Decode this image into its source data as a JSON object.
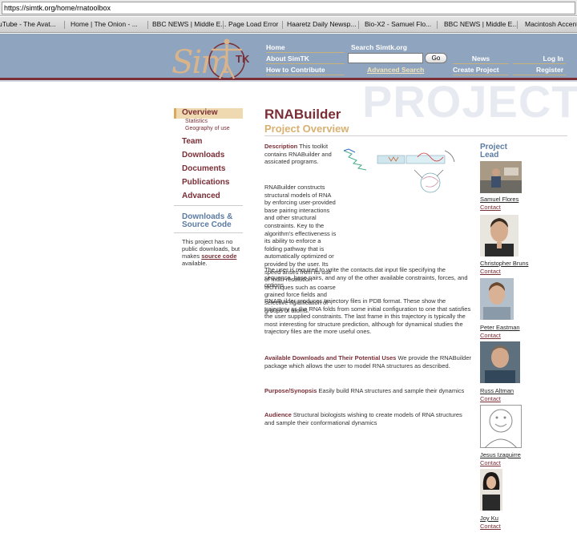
{
  "browser": {
    "url": "https://simtk.org/home/rnatoolbox",
    "bookmarks": [
      "uTube - The Avat...",
      "Home | The Onion - ...",
      "BBC NEWS | Middle E...",
      "Page Load Error",
      "Haaretz Daily Newsp...",
      "Bio-X2 - Samuel Flo...",
      "BBC NEWS | Middle E...",
      "Macintosh Accent"
    ]
  },
  "header": {
    "logo_text": "Sim",
    "logo_tk": "TK",
    "nav_left": [
      "Home",
      "About SimTK",
      "How to Contribute"
    ],
    "search_label": "Search Simtk.org",
    "search_value": "",
    "go_label": "Go",
    "advanced_search": "Advanced Search",
    "nav_mid": [
      "News",
      "Create Project"
    ],
    "nav_right": [
      "Log In",
      "Register"
    ],
    "watermark": "PROJECT"
  },
  "sidebar": {
    "active": "Overview",
    "subs": [
      "Statistics",
      "Geography of use"
    ],
    "items": [
      "Team",
      "Downloads",
      "Documents",
      "Publications",
      "Advanced"
    ],
    "downloads_title_1": "Downloads &",
    "downloads_title_2": "Source Code",
    "downloads_text_before": "This project has no public downloads, but makes ",
    "downloads_link": "source code",
    "downloads_text_after": " available."
  },
  "main": {
    "title": "RNABuilder",
    "subtitle": "Project Overview",
    "description_label": "Description",
    "description_intro": " This toolkit contains RNABuilder and assicated programs.",
    "para1": "RNABuilder constructs structural models of RNA by enforcing user-provided base pairing interactions and other structural constraints. Key to the algorithm's effectiveness is its ability to enforce a folding pathway that is automatically optimized or provided by the user. Its speed arises from its use of multi-resolution techniques such as coarse grained force fields and selective rigidification of groups of atoms.",
    "para2": "The user is required to write the contacts.dat input file specifying the sequence, base pairs, and any of the other available constraints, forces, and options.",
    "para3": "RNABuilder produces trajectory files in PDB format. These show the trajectory as the RNA folds from some initial configuration to one that satisfies the user supplied constraints. The last frame in this trajectory is typically the most interesting for structure prediction, although for dynamical studies the trajectory files are the more useful ones.",
    "downloads_label": "Available Downloads and Their Potential Uses",
    "downloads_text": " We provide the RNABuilder package which allows the user to model RNA structures as described.",
    "purpose_label": "Purpose/Synopsis",
    "purpose_text": " Easily build RNA structures and sample their dynamics",
    "audience_label": "Audience",
    "audience_text": " Structural biologists wishing to create models of RNA structures and sample their conformational dynamics"
  },
  "project_leads": {
    "title_1": "Project",
    "title_2": "Lead",
    "contact_label": "Contact",
    "people": [
      {
        "name": "Samuel Flores"
      },
      {
        "name": "Christopher Bruns"
      },
      {
        "name": "Peter Eastman"
      },
      {
        "name": "Russ Altman"
      },
      {
        "name": "Jesus Izaguirre"
      },
      {
        "name": "Joy Ku"
      }
    ]
  },
  "colors": {
    "banner": "#8fa4bf",
    "maroon": "#7a2e36",
    "gold": "#d9b070",
    "blue_heading": "#5b7aa2"
  }
}
